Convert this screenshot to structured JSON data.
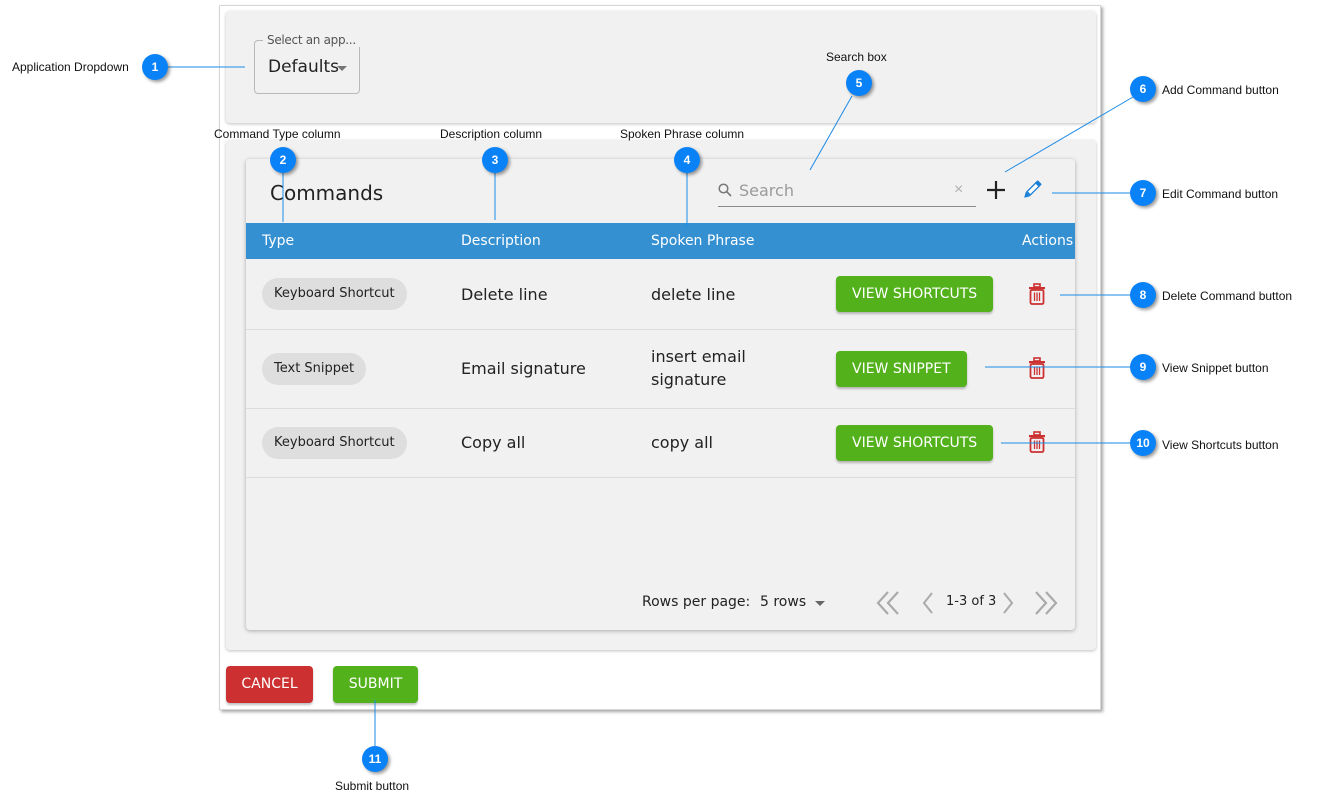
{
  "app_select": {
    "legend": "Select an app...",
    "value": "Defaults"
  },
  "commands": {
    "title": "Commands",
    "search_placeholder": "Search",
    "clear_glyph": "×",
    "columns": {
      "type": "Type",
      "description": "Description",
      "spoken_phrase": "Spoken Phrase",
      "actions": "Actions"
    },
    "rows": [
      {
        "type": "Keyboard Shortcut",
        "description": "Delete line",
        "spoken_phrase": "delete line",
        "action_label": "VIEW SHORTCUTS"
      },
      {
        "type": "Text Snippet",
        "description": "Email signature",
        "spoken_phrase_line1": "insert email",
        "spoken_phrase_line2": "signature",
        "action_label": "VIEW SNIPPET"
      },
      {
        "type": "Keyboard Shortcut",
        "description": "Copy all",
        "spoken_phrase": "copy all",
        "action_label": "VIEW SHORTCUTS"
      }
    ],
    "pagination": {
      "rows_per_page_label": "Rows per page:",
      "rows_per_page_value": "5 rows",
      "range": "1-3 of 3"
    }
  },
  "footer": {
    "cancel_label": "CANCEL",
    "submit_label": "SUBMIT"
  },
  "callouts": [
    {
      "num": "1",
      "label": "Application Dropdown"
    },
    {
      "num": "2",
      "label": "Command Type column"
    },
    {
      "num": "3",
      "label": "Description column"
    },
    {
      "num": "4",
      "label": "Spoken Phrase column"
    },
    {
      "num": "5",
      "label": "Search box"
    },
    {
      "num": "6",
      "label": "Add Command button"
    },
    {
      "num": "7",
      "label": "Edit Command button"
    },
    {
      "num": "8",
      "label": "Delete Command button"
    },
    {
      "num": "9",
      "label": "View Snippet button"
    },
    {
      "num": "10",
      "label": "View Shortcuts button"
    },
    {
      "num": "11",
      "label": "Submit button"
    }
  ],
  "colors": {
    "header_blue": "#3590d2",
    "action_green": "#53b21c",
    "cancel_red": "#cc3030",
    "delete_red": "#cc3030",
    "callout_blue": "#0a82f7"
  }
}
